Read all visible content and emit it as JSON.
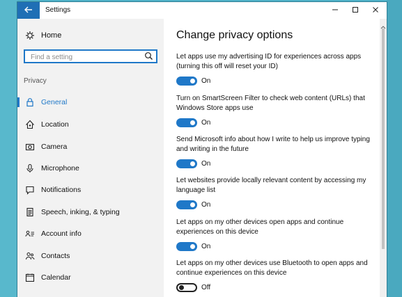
{
  "window": {
    "title": "Settings"
  },
  "titlebar": {
    "back_icon": "back-arrow-icon",
    "minimize_icon": "minimize-icon",
    "maximize_icon": "maximize-icon",
    "close_icon": "close-icon"
  },
  "sidebar": {
    "home_label": "Home",
    "search_placeholder": "Find a setting",
    "section_label": "Privacy",
    "items": [
      {
        "label": "General",
        "icon": "lock-icon",
        "active": true
      },
      {
        "label": "Location",
        "icon": "location-icon",
        "active": false
      },
      {
        "label": "Camera",
        "icon": "camera-icon",
        "active": false
      },
      {
        "label": "Microphone",
        "icon": "microphone-icon",
        "active": false
      },
      {
        "label": "Notifications",
        "icon": "notifications-icon",
        "active": false
      },
      {
        "label": "Speech, inking, & typing",
        "icon": "document-icon",
        "active": false
      },
      {
        "label": "Account info",
        "icon": "account-info-icon",
        "active": false
      },
      {
        "label": "Contacts",
        "icon": "contacts-icon",
        "active": false
      },
      {
        "label": "Calendar",
        "icon": "calendar-icon",
        "active": false
      }
    ]
  },
  "main": {
    "heading": "Change privacy options",
    "settings": [
      {
        "description": "Let apps use my advertising ID for experiences across apps (turning this off will reset your ID)",
        "state_label": "On",
        "state": true
      },
      {
        "description": "Turn on SmartScreen Filter to check web content (URLs) that Windows Store apps use",
        "state_label": "On",
        "state": true
      },
      {
        "description": "Send Microsoft info about how I write to help us improve typing and writing in the future",
        "state_label": "On",
        "state": true
      },
      {
        "description": "Let websites provide locally relevant content by accessing my language list",
        "state_label": "On",
        "state": true
      },
      {
        "description": "Let apps on my other devices open apps and continue experiences on this device",
        "state_label": "On",
        "state": true
      },
      {
        "description": "Let apps on my other devices use Bluetooth to open apps and continue experiences on this device",
        "state_label": "Off",
        "state": false
      }
    ]
  },
  "colors": {
    "accent": "#1f78c8",
    "desktop": "#4fb0c6",
    "sidebar_bg": "#f2f2f2"
  }
}
